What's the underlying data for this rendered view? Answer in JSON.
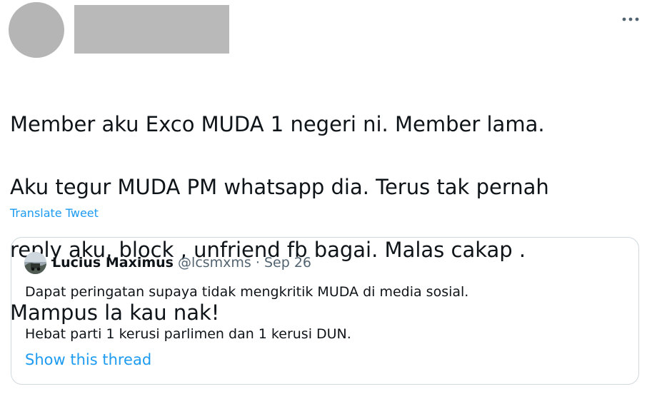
{
  "tweet": {
    "more_icon": "more-horizontal-icon",
    "text_lines": [
      "Member aku Exco MUDA 1 negeri ni. Member lama.",
      "Aku tegur MUDA PM whatsapp dia. Terus tak pernah",
      "reply aku, block , unfriend fb bagai. Malas cakap .",
      "Mampus la kau nak!"
    ],
    "translate_label": "Translate Tweet",
    "link_color": "#1d9bf0"
  },
  "quote": {
    "author_name": "Lucius Maximus",
    "handle": "@lcsmxms",
    "separator": "·",
    "date": "Sep 26",
    "line1": "Dapat peringatan supaya tidak mengkritik MUDA di media sosial.",
    "line2": "Hebat parti 1 kerusi parlimen dan 1 kerusi DUN.",
    "show_thread_label": "Show this thread"
  }
}
